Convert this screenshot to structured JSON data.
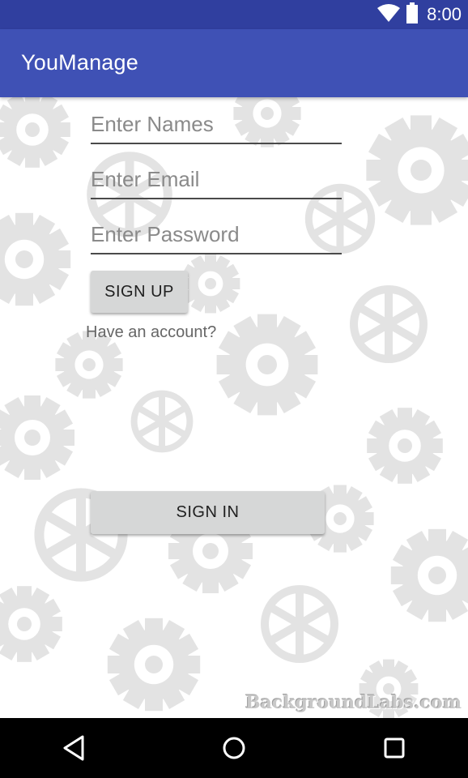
{
  "status_bar": {
    "time": "8:00",
    "icons": [
      "wifi-icon",
      "battery-icon"
    ]
  },
  "app_bar": {
    "title": "YouManage"
  },
  "form": {
    "names_placeholder": "Enter Names",
    "names_value": "",
    "email_placeholder": "Enter Email",
    "email_value": "",
    "password_placeholder": "Enter Password",
    "password_value": "",
    "signup_label": "SIGN UP",
    "have_account_text": "Have an account?",
    "signin_label": "SIGN IN"
  },
  "background": {
    "watermark": "BackgroundLabs.com"
  },
  "nav_bar": {
    "icons": [
      "back-icon",
      "home-icon",
      "recents-icon"
    ]
  },
  "colors": {
    "status_bar": "#303f9f",
    "app_bar": "#3f51b5",
    "button": "#d6d7d7",
    "pattern_gear": "#e3e3e3",
    "nav_bar": "#000000"
  }
}
